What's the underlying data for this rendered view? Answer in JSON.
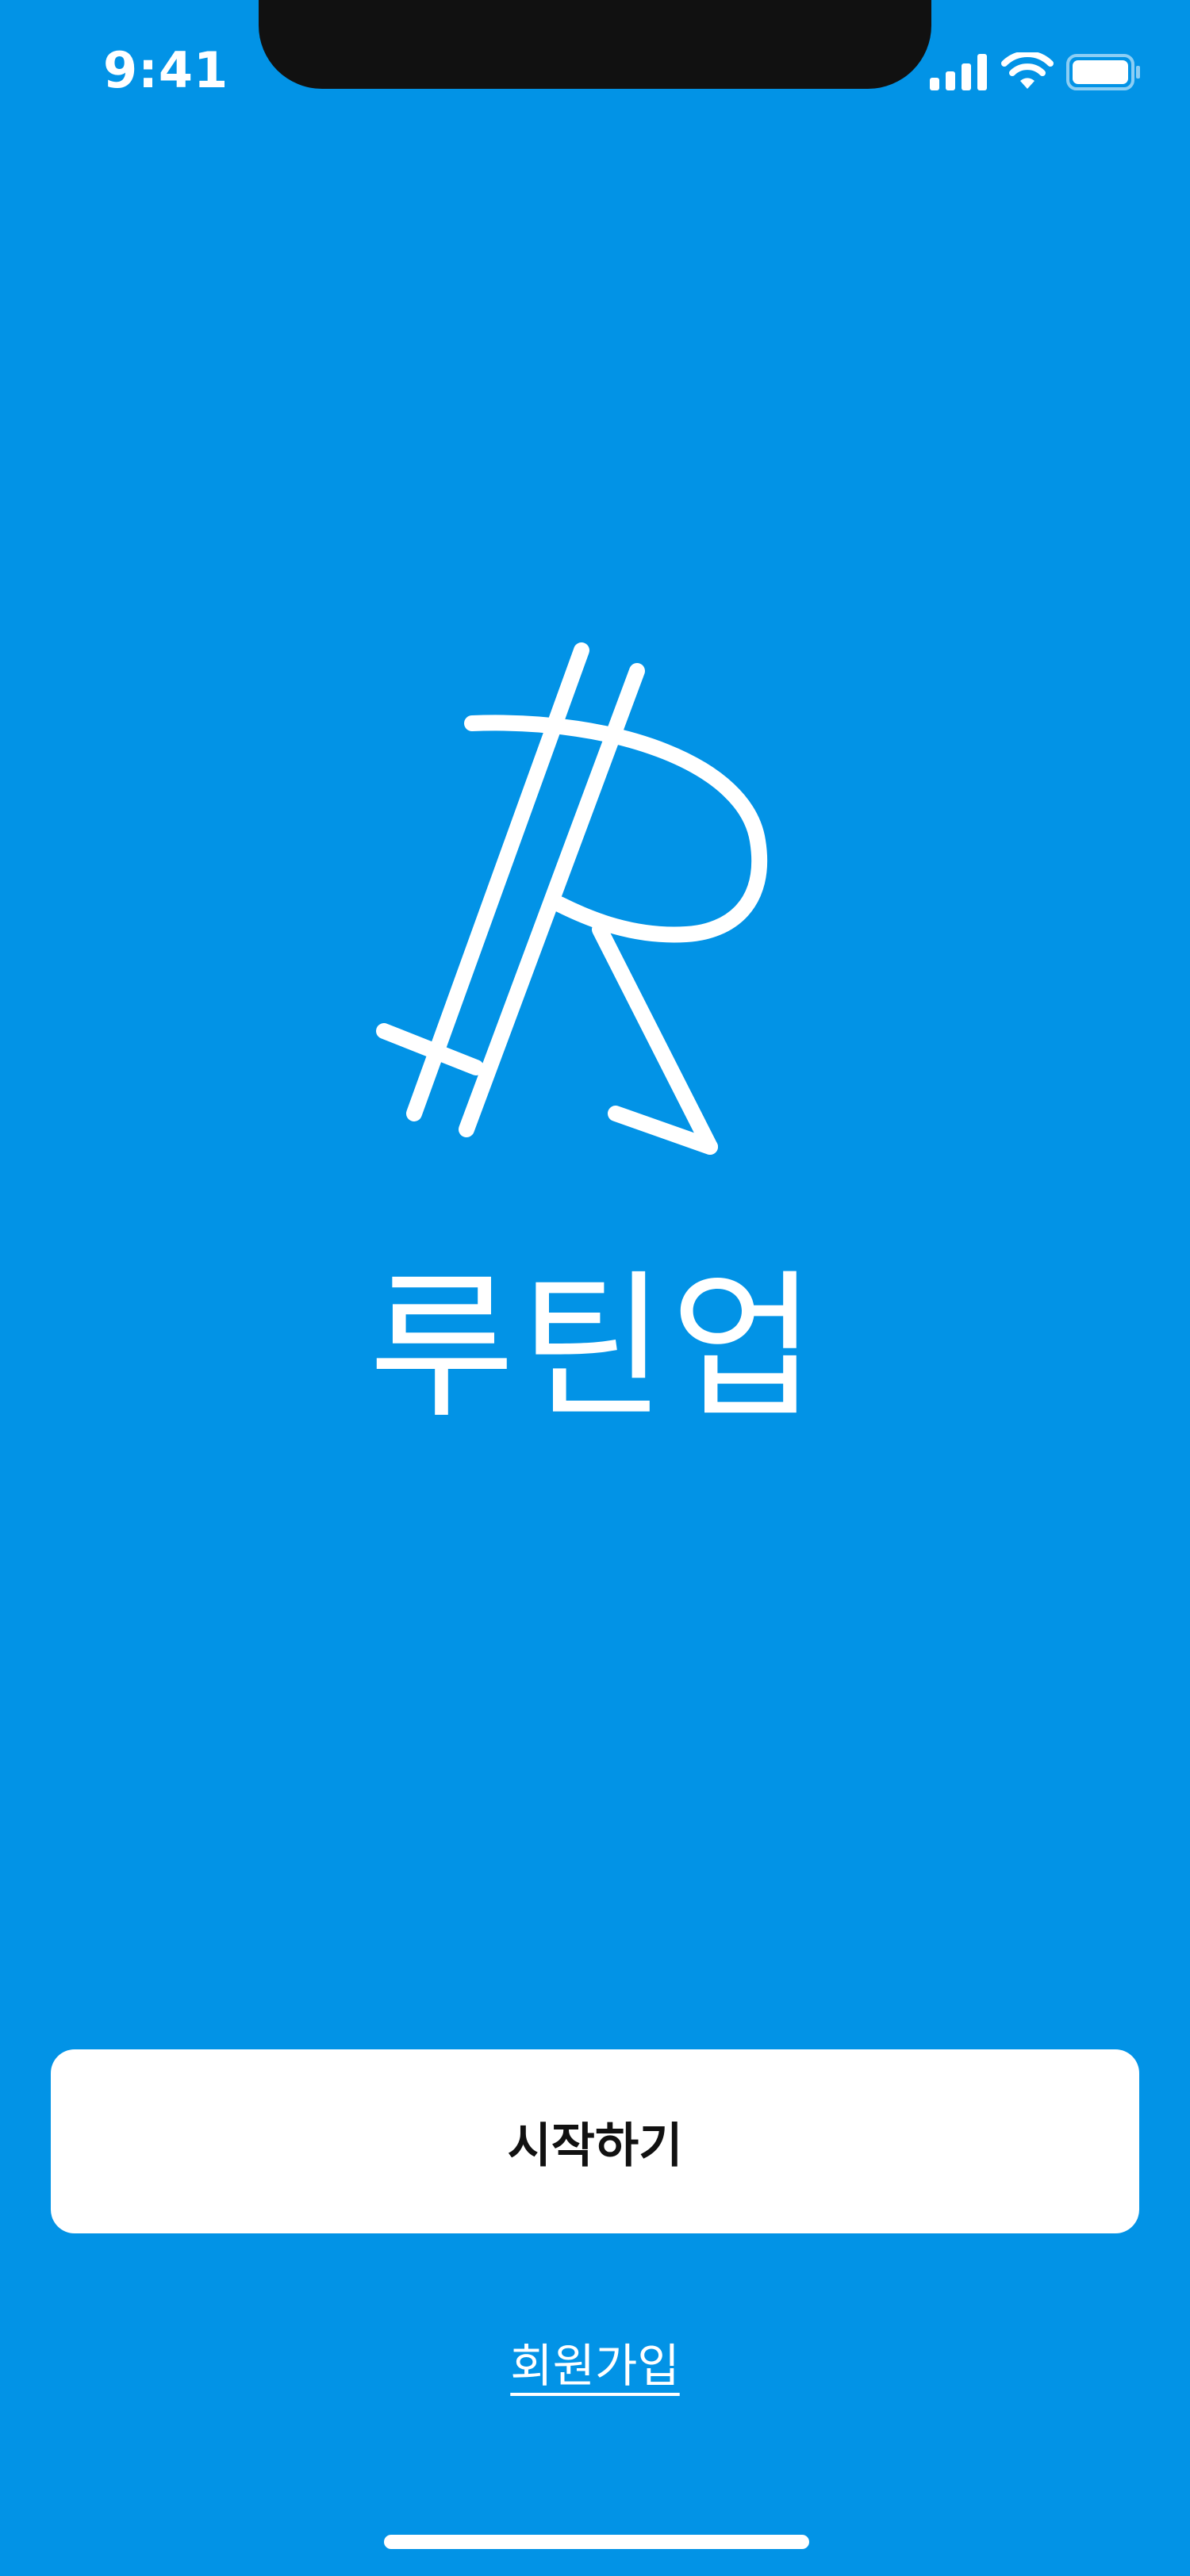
{
  "status_bar": {
    "time": "9:41"
  },
  "splash": {
    "logo_icon": "routine-up-r-logo",
    "app_name": "루틴업"
  },
  "actions": {
    "start_label": "시작하기",
    "signup_label": "회원가입"
  },
  "colors": {
    "background": "#0293e6",
    "button_background": "#ffffff",
    "button_text": "#111111",
    "foreground": "#ffffff"
  }
}
